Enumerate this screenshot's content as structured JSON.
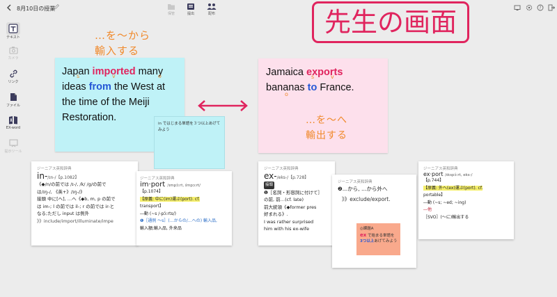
{
  "header": {
    "title": "8月10日の授業",
    "toolbar": [
      {
        "label": "保管",
        "icon": "folder-icon",
        "enabled": false
      },
      {
        "label": "提出",
        "icon": "submit-tray-icon",
        "enabled": true
      },
      {
        "label": "配布",
        "icon": "distribute-people-icon",
        "enabled": true
      }
    ]
  },
  "banner": {
    "text": "先生の画面",
    "color": "#e0245e"
  },
  "sidebar": {
    "items": [
      {
        "label": "テキスト",
        "icon": "text-card-icon",
        "active": true
      },
      {
        "label": "カメラ",
        "icon": "camera-icon",
        "enabled": false
      },
      {
        "label": "リンク",
        "icon": "link-icon"
      },
      {
        "label": "ファイル",
        "icon": "file-icon"
      },
      {
        "label": "EX-word",
        "icon": "dictionary-icon"
      },
      {
        "label": "提示ツール",
        "icon": "present-tool-icon",
        "enabled": false
      }
    ]
  },
  "cards": {
    "left": {
      "text_1": "Japan",
      "word_1": "imported",
      "text_2": "many ideas",
      "word_2": "from",
      "text_3": "the West at the time of the Meiji Restoration.",
      "bg": "#bff2f7"
    },
    "right": {
      "text_1": "Jamaica",
      "word_1": "exports",
      "text_2": "bananas",
      "word_2": "to",
      "text_3": "France.",
      "bg": "#fde0ec"
    },
    "left_note": "…を～から\n輸入する",
    "right_note": "…を～へ\n輸出する",
    "mark_s": "s",
    "mark_v": "v",
    "mark_o": "o",
    "sticky_1": {
      "text": "in ではじまる単語を３つ以上あげてみよう",
      "bg": "#bff2f7"
    },
    "sticky_2": {
      "title": "◎課題A",
      "prefix": "ex",
      "line1": "で始まる単語を",
      "line2_em": "3つ以上",
      "line2": "あげてみよう",
      "bg": "#f9a98c"
    }
  },
  "dictionary": {
    "source": "ジーニアス英和辞典",
    "d1": {
      "head": "in-",
      "pron": "/ɪn-/",
      "ref": "【p.1082】",
      "lines": [
        "《◆/n/の前では /ɪ-/, /k/ /g/の前で",
        "は/ɪŋ-/, 《英+》/ɪŋ-/》",
        "接頭 中に[へ], …へ《◆b, m, p の前で",
        "は im-; l の前では il-; r の前では ir-と",
        "なる;ただし input は例外",
        "》》include/import/illuminate/impe"
      ]
    },
    "d2": {
      "head": "im·port",
      "pron": "/ɪmpɔ́ːrt, ɪ́mpɔːrt/",
      "ref": "【p.1074】",
      "lines": [
        "【原義: 中に(im)運ぶ(port). cf.",
        "transport】",
        "―動 (~s /-pɔ́ːrts/)",
        "❶［通例 ～s］(…からの/…への) 輸入品,",
        "輸入額;輸入品, 外来品"
      ]
    },
    "d3": {
      "head": "ex-",
      "pron": "/eks-/",
      "ref": "【p.728】",
      "lines": [
        "接頭",
        "❶［名詞・形容詞に付けて］",
        "の前, 前…(cf. late)",
        "前大統領《◆former pres",
        "好まれる》.",
        "I was rather surprised",
        "him with his ex-wife"
      ]
    },
    "d4": {
      "line1": "❷…から, …から外へ",
      "line2": "》》exclude/export."
    },
    "d5": {
      "head": "ex·port",
      "pron": "/ɪkspɔ́ːrt, eks-/",
      "ref": "【p.744】",
      "lines": [
        "【原義: 外へ(ex)運ぶ(port). cf.",
        "portable】",
        "―動 (~s; ~ed; ~ing)",
        "―他",
        "［SVO］(～に)輸出する"
      ]
    }
  }
}
